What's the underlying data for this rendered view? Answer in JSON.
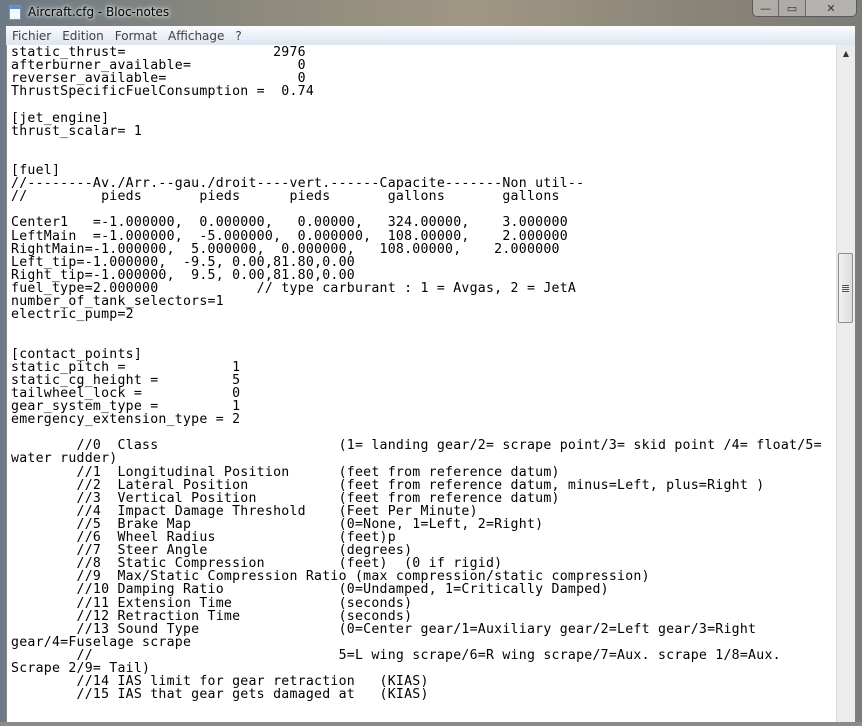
{
  "window": {
    "title": "Aircraft.cfg - Bloc-notes",
    "controls": {
      "minimize": "—",
      "maximize": "▭",
      "close": "✕"
    }
  },
  "menu": [
    "Fichier",
    "Edition",
    "Format",
    "Affichage",
    "?"
  ],
  "editor": {
    "lines": [
      "static_thrust=                  2976",
      "afterburner_available=             0",
      "reverser_available=                0",
      "ThrustSpecificFuelConsumption =  0.74",
      "",
      "[jet_engine]",
      "thrust_scalar= 1",
      "",
      "",
      "[fuel]",
      "//--------Av./Arr.--gau./droit----vert.------Capacite-------Non util--",
      "//         pieds       pieds      pieds       gallons       gallons",
      "",
      "Center1   =-1.000000,  0.000000,   0.00000,   324.00000,    3.000000",
      "LeftMain  =-1.000000,  -5.000000,  0.000000,  108.00000,    2.000000",
      "RightMain=-1.000000,  5.000000,  0.000000,   108.00000,    2.000000",
      "Left_tip=-1.000000,  -9.5, 0.00,81.80,0.00",
      "Right_tip=-1.000000,  9.5, 0.00,81.80,0.00",
      "fuel_type=2.000000            // type carburant : 1 = Avgas, 2 = JetA",
      "number_of_tank_selectors=1",
      "electric_pump=2",
      "",
      "",
      "[contact_points]",
      "static_pitch =             1",
      "static_cg_height =         5",
      "tailwheel_lock =           0",
      "gear_system_type =         1",
      "emergency_extension_type = 2",
      "",
      "        //0  Class                      (1= landing gear/2= scrape point/3= skid point /4= float/5=",
      "water rudder)",
      "        //1  Longitudinal Position      (feet from reference datum)",
      "        //2  Lateral Position           (feet from reference datum, minus=Left, plus=Right )",
      "        //3  Vertical Position          (feet from reference datum)",
      "        //4  Impact Damage Threshold    (Feet Per Minute)",
      "        //5  Brake Map                  (0=None, 1=Left, 2=Right)",
      "        //6  Wheel Radius               (feet)p",
      "        //7  Steer Angle                (degrees)",
      "        //8  Static Compression         (feet)  (0 if rigid)",
      "        //9  Max/Static Compression Ratio (max compression/static compression)",
      "        //10 Damping Ratio              (0=Undamped, 1=Critically Damped)",
      "        //11 Extension Time             (seconds)",
      "        //12 Retraction Time            (seconds)",
      "        //13 Sound Type                 (0=Center gear/1=Auxiliary gear/2=Left gear/3=Right",
      "gear/4=Fuselage scrape",
      "        //                              5=L wing scrape/6=R wing scrape/7=Aux. scrape 1/8=Aux.",
      "Scrape 2/9= Tail)",
      "        //14 IAS limit for gear retraction   (KIAS)",
      "        //15 IAS that gear gets damaged at   (KIAS)"
    ]
  },
  "scrollbar": {
    "position_fraction": 0.32,
    "up_arrow": "▲"
  }
}
